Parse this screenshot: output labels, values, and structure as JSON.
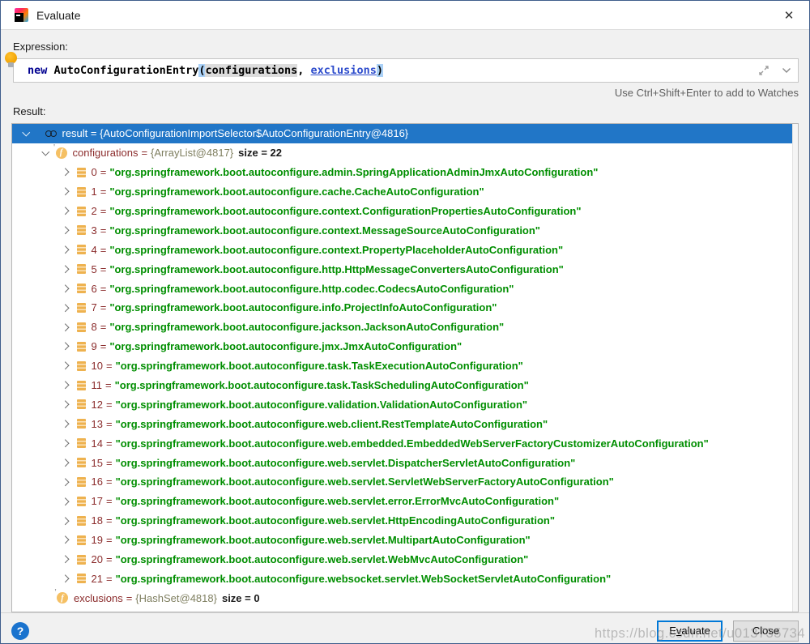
{
  "window": {
    "title": "Evaluate",
    "close_icon": "✕"
  },
  "colors": {
    "selection_blue": "#2176C7",
    "string_green": "#008E00",
    "name_maroon": "#8B2C2C",
    "type_grey": "#7F7F60",
    "focus_border": "#0078D7"
  },
  "expression": {
    "label": "Expression:",
    "tokens": {
      "keyword": "new",
      "space": " ",
      "class_name": "AutoConfigurationEntry",
      "open_paren": "(",
      "arg1": "configurations",
      "comma": ", ",
      "arg2": "exclusions",
      "close_paren": ")"
    },
    "hint": "Use Ctrl+Shift+Enter to add to Watches"
  },
  "result": {
    "label": "Result:",
    "equals_sign": "=",
    "root_text": "result = {AutoConfigurationImportSelector$AutoConfigurationEntry@4816}",
    "configurations": {
      "name": "configurations",
      "type": "{ArrayList@4817}",
      "size": "size = 22"
    },
    "items": [
      {
        "index": "0",
        "value": "\"org.springframework.boot.autoconfigure.admin.SpringApplicationAdminJmxAutoConfiguration\""
      },
      {
        "index": "1",
        "value": "\"org.springframework.boot.autoconfigure.cache.CacheAutoConfiguration\""
      },
      {
        "index": "2",
        "value": "\"org.springframework.boot.autoconfigure.context.ConfigurationPropertiesAutoConfiguration\""
      },
      {
        "index": "3",
        "value": "\"org.springframework.boot.autoconfigure.context.MessageSourceAutoConfiguration\""
      },
      {
        "index": "4",
        "value": "\"org.springframework.boot.autoconfigure.context.PropertyPlaceholderAutoConfiguration\""
      },
      {
        "index": "5",
        "value": "\"org.springframework.boot.autoconfigure.http.HttpMessageConvertersAutoConfiguration\""
      },
      {
        "index": "6",
        "value": "\"org.springframework.boot.autoconfigure.http.codec.CodecsAutoConfiguration\""
      },
      {
        "index": "7",
        "value": "\"org.springframework.boot.autoconfigure.info.ProjectInfoAutoConfiguration\""
      },
      {
        "index": "8",
        "value": "\"org.springframework.boot.autoconfigure.jackson.JacksonAutoConfiguration\""
      },
      {
        "index": "9",
        "value": "\"org.springframework.boot.autoconfigure.jmx.JmxAutoConfiguration\""
      },
      {
        "index": "10",
        "value": "\"org.springframework.boot.autoconfigure.task.TaskExecutionAutoConfiguration\""
      },
      {
        "index": "11",
        "value": "\"org.springframework.boot.autoconfigure.task.TaskSchedulingAutoConfiguration\""
      },
      {
        "index": "12",
        "value": "\"org.springframework.boot.autoconfigure.validation.ValidationAutoConfiguration\""
      },
      {
        "index": "13",
        "value": "\"org.springframework.boot.autoconfigure.web.client.RestTemplateAutoConfiguration\""
      },
      {
        "index": "14",
        "value": "\"org.springframework.boot.autoconfigure.web.embedded.EmbeddedWebServerFactoryCustomizerAutoConfiguration\""
      },
      {
        "index": "15",
        "value": "\"org.springframework.boot.autoconfigure.web.servlet.DispatcherServletAutoConfiguration\""
      },
      {
        "index": "16",
        "value": "\"org.springframework.boot.autoconfigure.web.servlet.ServletWebServerFactoryAutoConfiguration\""
      },
      {
        "index": "17",
        "value": "\"org.springframework.boot.autoconfigure.web.servlet.error.ErrorMvcAutoConfiguration\""
      },
      {
        "index": "18",
        "value": "\"org.springframework.boot.autoconfigure.web.servlet.HttpEncodingAutoConfiguration\""
      },
      {
        "index": "19",
        "value": "\"org.springframework.boot.autoconfigure.web.servlet.MultipartAutoConfiguration\""
      },
      {
        "index": "20",
        "value": "\"org.springframework.boot.autoconfigure.web.servlet.WebMvcAutoConfiguration\""
      },
      {
        "index": "21",
        "value": "\"org.springframework.boot.autoconfigure.websocket.servlet.WebSocketServletAutoConfiguration\""
      }
    ],
    "exclusions": {
      "name": "exclusions",
      "type": "{HashSet@4818}",
      "size": "size = 0"
    }
  },
  "footer": {
    "help_icon": "?",
    "evaluate_button": {
      "pre": "E",
      "mnemonic": "v",
      "post": "aluate"
    },
    "close_button": "Close",
    "watermark": "https://blog.csdn.net/u013735734"
  }
}
